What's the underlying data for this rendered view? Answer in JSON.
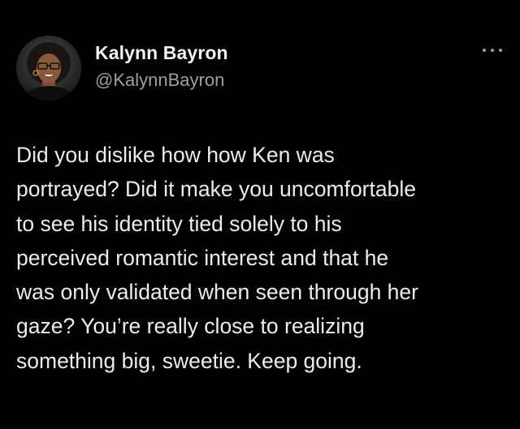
{
  "tweet": {
    "author": {
      "display_name": "Kalynn Bayron",
      "handle": "@KalynnBayron",
      "avatar_icon": "profile-photo-icon"
    },
    "more_icon": "more-options-icon",
    "text_lines": [
      "Did you dislike how how Ken was",
      "portrayed? Did it make you uncomfortable",
      "to see his identity tied solely to his",
      "perceived romantic interest and that he",
      "was only validated when seen through her",
      "gaze? You’re really close to realizing",
      "something big, sweetie. Keep going."
    ]
  },
  "colors": {
    "background": "#000000",
    "primary_text": "#ececec",
    "secondary_text": "#9aa0a6"
  }
}
